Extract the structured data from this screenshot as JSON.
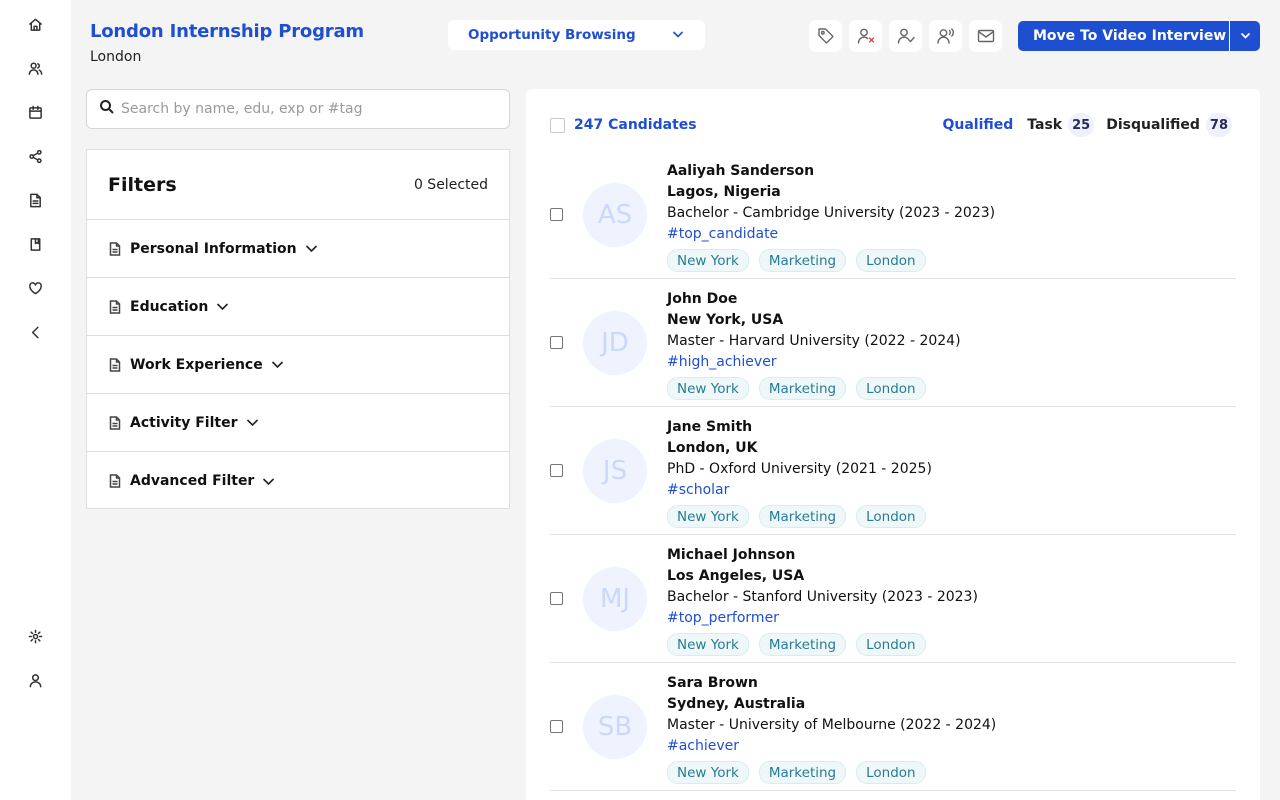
{
  "header": {
    "title": "London Internship Program",
    "subtitle": "London",
    "stage_dropdown": "Opportunity Browsing",
    "move_button": "Move To Video Interview I"
  },
  "toolbar_icons": [
    "tag-icon",
    "user-remove-icon",
    "user-check-icon",
    "user-voice-icon",
    "mail-icon"
  ],
  "sidebar_icons": [
    "home-icon",
    "users-icon",
    "calendar-icon",
    "share-icon",
    "document-icon",
    "book-icon",
    "heart-icon",
    "collapse-icon",
    "settings-icon",
    "profile-icon"
  ],
  "search": {
    "placeholder": "Search by name, edu, exp or #tag"
  },
  "filters": {
    "title": "Filters",
    "selected": "0 Selected",
    "sections": [
      "Personal Information",
      "Education",
      "Work Experience",
      "Activity Filter",
      "Advanced Filter"
    ]
  },
  "candidates_panel": {
    "count_label": "247 Candidates",
    "tabs": [
      {
        "label": "Qualified",
        "count": ""
      },
      {
        "label": "Task",
        "count": "25"
      },
      {
        "label": "Disqualified",
        "count": "78"
      }
    ]
  },
  "candidates": [
    {
      "initials": "AS",
      "name": "Aaliyah Sanderson",
      "location": "Lagos, Nigeria",
      "education": "Bachelor - Cambridge University (2023 - 2023)",
      "tag": "#top_candidate",
      "chips": [
        "New York",
        "Marketing",
        "London"
      ]
    },
    {
      "initials": "JD",
      "name": "John Doe",
      "location": "New York, USA",
      "education": "Master - Harvard University (2022 - 2024)",
      "tag": "#high_achiever",
      "chips": [
        "New York",
        "Marketing",
        "London"
      ]
    },
    {
      "initials": "JS",
      "name": "Jane Smith",
      "location": "London, UK",
      "education": "PhD - Oxford University (2021 - 2025)",
      "tag": "#scholar",
      "chips": [
        "New York",
        "Marketing",
        "London"
      ]
    },
    {
      "initials": "MJ",
      "name": "Michael Johnson",
      "location": "Los Angeles, USA",
      "education": "Bachelor - Stanford University (2023 - 2023)",
      "tag": "#top_performer",
      "chips": [
        "New York",
        "Marketing",
        "London"
      ]
    },
    {
      "initials": "SB",
      "name": "Sara Brown",
      "location": "Sydney, Australia",
      "education": "Master - University of Melbourne (2022 - 2024)",
      "tag": "#achiever",
      "chips": [
        "New York",
        "Marketing",
        "London"
      ]
    }
  ],
  "colors": {
    "accent": "#1f4fd1",
    "chip_text": "#2b7a92",
    "avatar_bg": "#eef3fe"
  }
}
